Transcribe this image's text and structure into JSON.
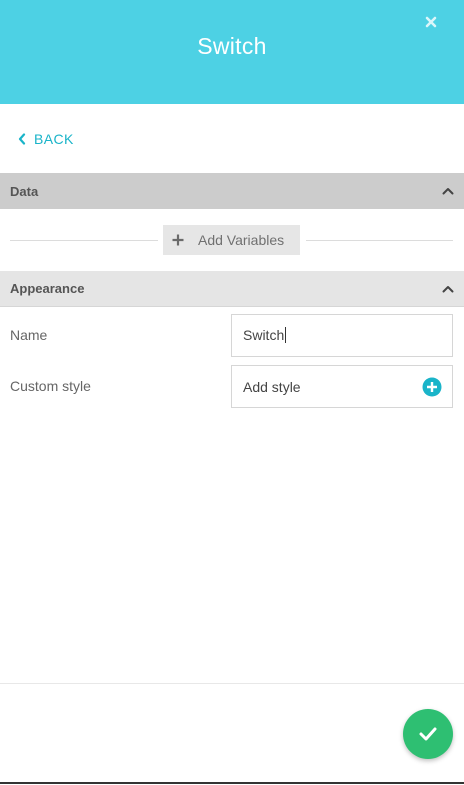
{
  "header": {
    "title": "Switch",
    "color": "#4dd1e4",
    "close_icon": "close-icon"
  },
  "back": {
    "label": "BACK",
    "icon": "chevron-left-icon"
  },
  "sections": {
    "data": {
      "title": "Data",
      "add_variables_label": "Add Variables"
    },
    "appearance": {
      "title": "Appearance",
      "fields": {
        "name_label": "Name",
        "name_value": "Switch",
        "custom_style_label": "Custom style",
        "custom_style_placeholder": "Add style"
      }
    }
  },
  "footer": {
    "confirm_icon": "checkmark-icon",
    "confirm_color": "#2ebf72"
  },
  "accent_color": "#1ab4c9"
}
